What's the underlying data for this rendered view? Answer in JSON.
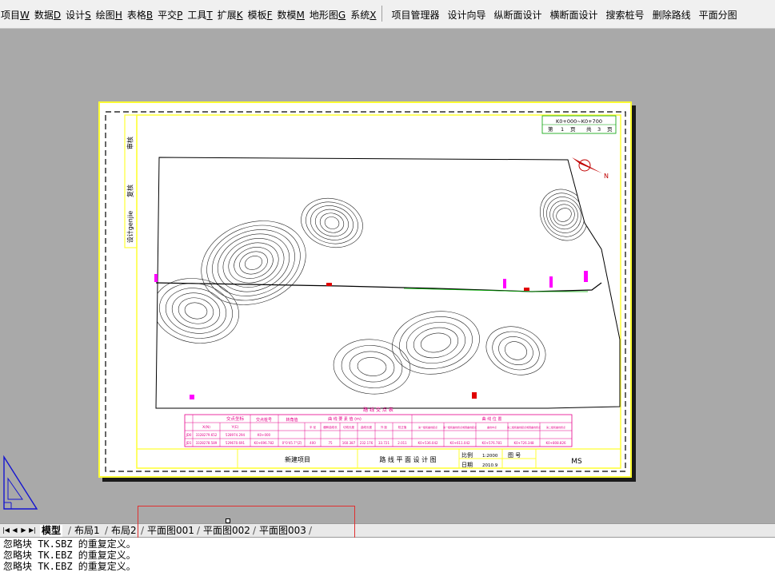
{
  "menubar": {
    "items": [
      {
        "label": "项目",
        "key": "W"
      },
      {
        "label": "数据",
        "key": "D"
      },
      {
        "label": "设计",
        "key": "S"
      },
      {
        "label": "绘图",
        "key": "H"
      },
      {
        "label": "表格",
        "key": "B"
      },
      {
        "label": "平交",
        "key": "P"
      },
      {
        "label": "工具",
        "key": "T"
      },
      {
        "label": "扩展",
        "key": "K"
      },
      {
        "label": "模板",
        "key": "F"
      },
      {
        "label": "数模",
        "key": "M"
      },
      {
        "label": "地形图",
        "key": "G"
      },
      {
        "label": "系统",
        "key": "X"
      }
    ],
    "toolbar_items": [
      "项目管理器",
      "设计向导",
      "纵断面设计",
      "横断面设计",
      "搜索桩号",
      "删除路线",
      "平面分图"
    ]
  },
  "drawing": {
    "chainage_range": "K0+000~K0+700",
    "page_label_1": "第",
    "page_current": "1",
    "page_label_2": "页",
    "page_label_3": "共",
    "page_total": "3",
    "page_label_4": "页",
    "side_review": "审核",
    "side_check": "复核",
    "side_design": "设计genjie",
    "project_name": "新建项目",
    "drawing_title": "路 线 平 面 设 计 图",
    "scale_label": "比例",
    "scale_value": "1:2000",
    "date_label": "日期",
    "date_value": "2010.9",
    "figure_label": "图  号",
    "figure_value": "MS",
    "table_header_1": "交点坐标",
    "table_header_2": "交点桩号",
    "table_header_3": "转角值",
    "table_header_4": "曲 线 要 素 值 (m)",
    "table_header_5": "曲 线 位 置",
    "table_sub_x": "X(N)",
    "table_sub_y": "Y(E)",
    "table_subheaders": [
      "半 径",
      "缓和曲线长",
      "切线长度",
      "曲线长度",
      "外 距",
      "校正值",
      "第一缓和曲线起点",
      "第一缓和曲线终点或圆曲线起点",
      "曲线中点",
      "第二缓和曲线起点或圆曲线终点",
      "第二缓和曲线终点"
    ],
    "row1": [
      "JD0",
      "3328279.652",
      "528974.294",
      "K0+000"
    ],
    "row2": [
      "JD1",
      "3328278.589",
      "529670.691",
      "K0+696.782",
      "0°0'45.7\"(Z)",
      "400",
      "75",
      "160.387",
      "232.176",
      "33.721",
      "2.011",
      "K0+536.042",
      "K0+611.042",
      "K0+576.781",
      "K0+726.348",
      "K0+808.826"
    ],
    "legend_title": "路 线 交 点 表",
    "north": "N"
  },
  "tabs": {
    "nav_first": "|◀",
    "nav_prev": "◀",
    "nav_next": "▶",
    "nav_last": "▶|",
    "items": [
      "模型",
      "布局1",
      "布局2",
      "平面图001",
      "平面图002",
      "平面图003"
    ]
  },
  "command": {
    "lines": [
      "忽略块 TK.SBZ 的重复定义。",
      "忽略块 TK.EBZ 的重复定义。",
      "忽略块 TK.EBZ 的重复定义。"
    ]
  },
  "colors": {
    "sheet_border": "#ffff33",
    "table_line": "#e6008a",
    "route_marker": "#ff00ff",
    "highlight": "#e03030"
  }
}
